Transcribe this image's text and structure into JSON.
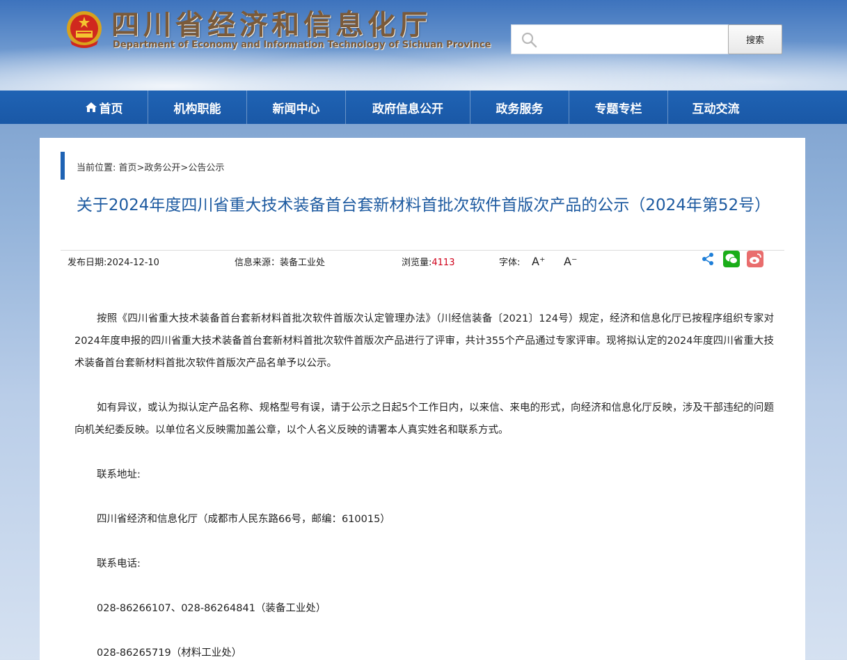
{
  "header": {
    "logo_cn": "四川省经济和信息化厅",
    "logo_en": "Department of Economy and Information Technology of Sichuan Province",
    "search": {
      "placeholder": "",
      "button_label": "搜索"
    }
  },
  "nav": {
    "items": [
      {
        "label": "首页",
        "icon": "home-icon"
      },
      {
        "label": "机构职能"
      },
      {
        "label": "新闻中心"
      },
      {
        "label": "政府信息公开"
      },
      {
        "label": "政务服务"
      },
      {
        "label": "专题专栏"
      },
      {
        "label": "互动交流"
      }
    ]
  },
  "breadcrumb": {
    "prefix": "当前位置:",
    "path": "首页>政务公开>公告公示"
  },
  "article": {
    "title": "关于2024年度四川省重大技术装备首台套新材料首批次软件首版次产品的公示（2024年第52号）",
    "publish_date_label": "发布日期:",
    "publish_date": "2024-12-10",
    "source_label": "信息来源：",
    "source": "装备工业处",
    "views_label": "浏览量:",
    "views": "4113",
    "font_label": "字体:",
    "font_increase": "A⁺",
    "font_decrease": "A⁻",
    "paragraphs": [
      "按照《四川省重大技术装备首台套新材料首批次软件首版次认定管理办法》（川经信装备〔2021〕124号）规定，经济和信息化厅已按程序组织专家对2024年度申报的四川省重大技术装备首台套新材料首批次软件首版次产品进行了评审，共计355个产品通过专家评审。现将拟认定的2024年度四川省重大技术装备首台套新材料首批次软件首版次产品名单予以公示。",
      "如有异议，或认为拟认定产品名称、规格型号有误，请于公示之日起5个工作日内，以来信、来电的形式，向经济和信息化厅反映，涉及干部违纪的问题向机关纪委反映。以单位名义反映需加盖公章，以个人名义反映的请署本人真实姓名和联系方式。"
    ],
    "contact_address_label": "联系地址:",
    "contact_address": "四川省经济和信息化厅（成都市人民东路66号，邮编：610015）",
    "contact_phone_label": "联系电话:",
    "phone_1": "028-86266107、028-86264841（装备工业处）",
    "phone_2": "028-86265719（材料工业处）"
  }
}
